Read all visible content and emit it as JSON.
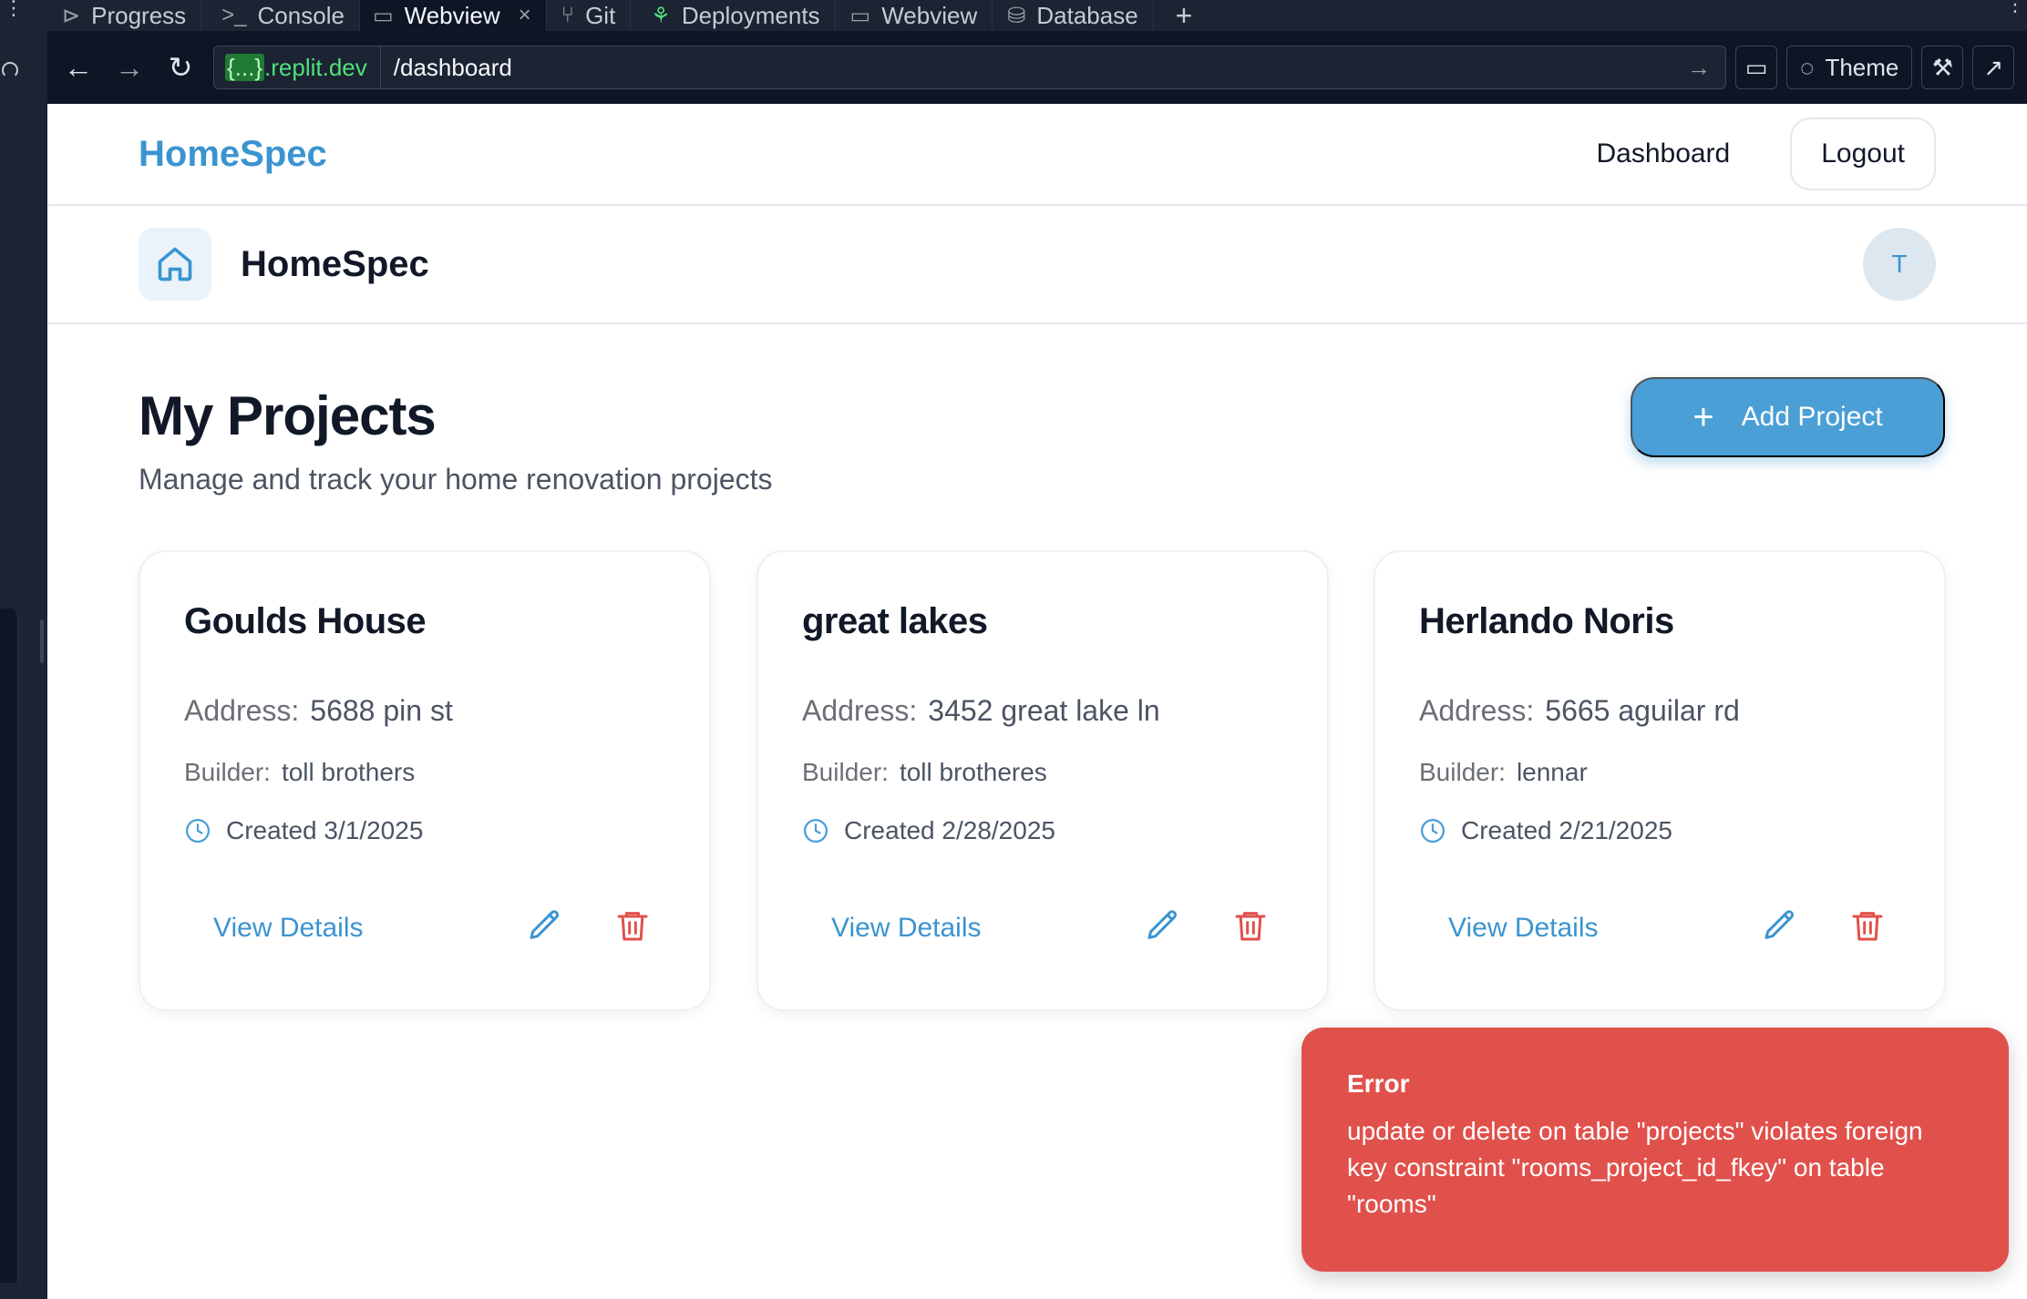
{
  "ide": {
    "tabs": [
      {
        "label": "Progress",
        "icon": "progress-icon"
      },
      {
        "label": "Console",
        "icon": "terminal-icon"
      },
      {
        "label": "Webview",
        "icon": "monitor-icon",
        "active": true
      },
      {
        "label": "Git",
        "icon": "git-icon"
      },
      {
        "label": "Deployments",
        "icon": "deploy-icon"
      },
      {
        "label": "Webview",
        "icon": "monitor-icon"
      },
      {
        "label": "Database",
        "icon": "database-icon"
      }
    ],
    "url_host": ".replit.dev",
    "url_host_prefix": "{...}",
    "url_path": "/dashboard",
    "theme_label": "Theme"
  },
  "app": {
    "brand": "HomeSpec",
    "nav_dashboard": "Dashboard",
    "nav_logout": "Logout",
    "sub_title": "HomeSpec",
    "avatar_initial": "T",
    "page_title": "My Projects",
    "page_subtitle": "Manage and track your home renovation projects",
    "add_project_label": "Add Project",
    "address_label": "Address:",
    "builder_label": "Builder:",
    "view_details_label": "View Details",
    "projects": [
      {
        "name": "Goulds House",
        "address": "5688 pin st",
        "builder": "toll brothers",
        "created": "Created 3/1/2025"
      },
      {
        "name": "great lakes",
        "address": "3452 great lake ln",
        "builder": "toll brotheres",
        "created": "Created 2/28/2025"
      },
      {
        "name": "Herlando Noris",
        "address": "5665 aguilar rd",
        "builder": "lennar",
        "created": "Created 2/21/2025"
      }
    ]
  },
  "toast": {
    "title": "Error",
    "message": "update or delete on table \"projects\" violates foreign key constraint \"rooms_project_id_fkey\" on table \"rooms\""
  },
  "colors": {
    "accent": "#3b94d0",
    "danger": "#e0514c",
    "ide_bg": "#1c2333"
  }
}
